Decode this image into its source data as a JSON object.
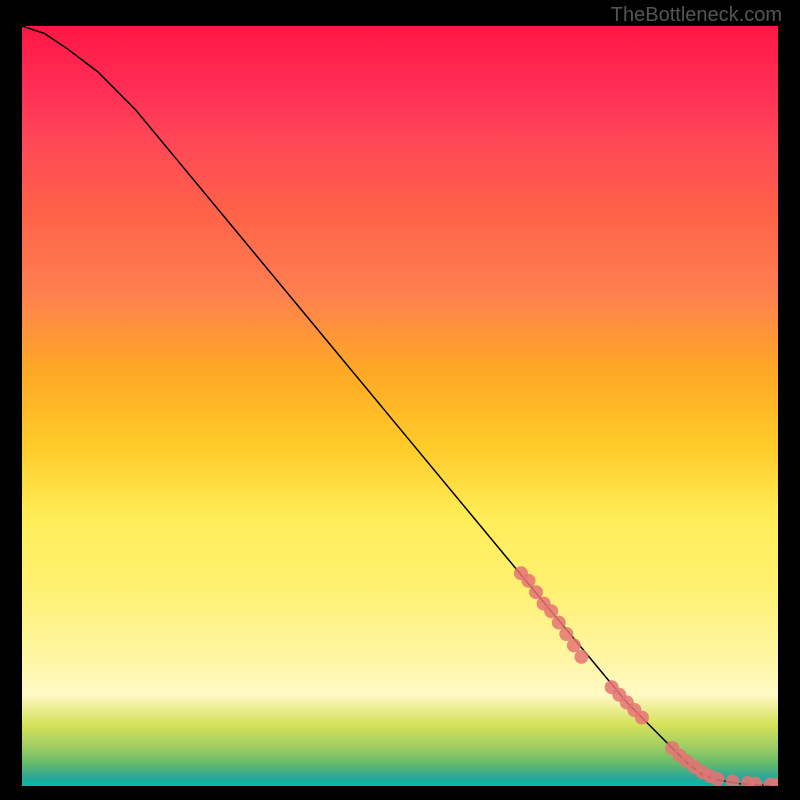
{
  "watermark": "TheBottleneck.com",
  "chart_data": {
    "type": "line",
    "title": "",
    "xlabel": "",
    "ylabel": "",
    "xlim": [
      0,
      100
    ],
    "ylim": [
      0,
      100
    ],
    "gradient": {
      "top_color": "#ff1744",
      "bottom_color": "#00bfa5",
      "description": "vertical gradient red-orange-yellow-green"
    },
    "series": [
      {
        "name": "bottleneck-curve",
        "type": "line",
        "x": [
          0,
          3,
          6,
          10,
          15,
          20,
          30,
          40,
          50,
          60,
          70,
          80,
          85,
          88,
          90,
          92,
          95,
          98,
          100
        ],
        "y": [
          100,
          99,
          97,
          94,
          89,
          83,
          71,
          59,
          47,
          35,
          23,
          11,
          6,
          3,
          1.5,
          0.8,
          0.3,
          0.1,
          0
        ]
      },
      {
        "name": "data-points",
        "type": "scatter",
        "x": [
          66,
          67,
          68,
          69,
          70,
          71,
          72,
          73,
          74,
          78,
          79,
          80,
          81,
          82,
          86,
          87,
          88,
          89,
          90,
          91,
          92,
          94,
          96,
          97,
          99,
          100
        ],
        "y": [
          28,
          27,
          25.5,
          24,
          23,
          21.5,
          20,
          18.5,
          17,
          13,
          12,
          11,
          10,
          9,
          5,
          4,
          3.2,
          2.5,
          1.8,
          1.3,
          0.9,
          0.6,
          0.4,
          0.3,
          0.2,
          0.15
        ]
      }
    ]
  }
}
